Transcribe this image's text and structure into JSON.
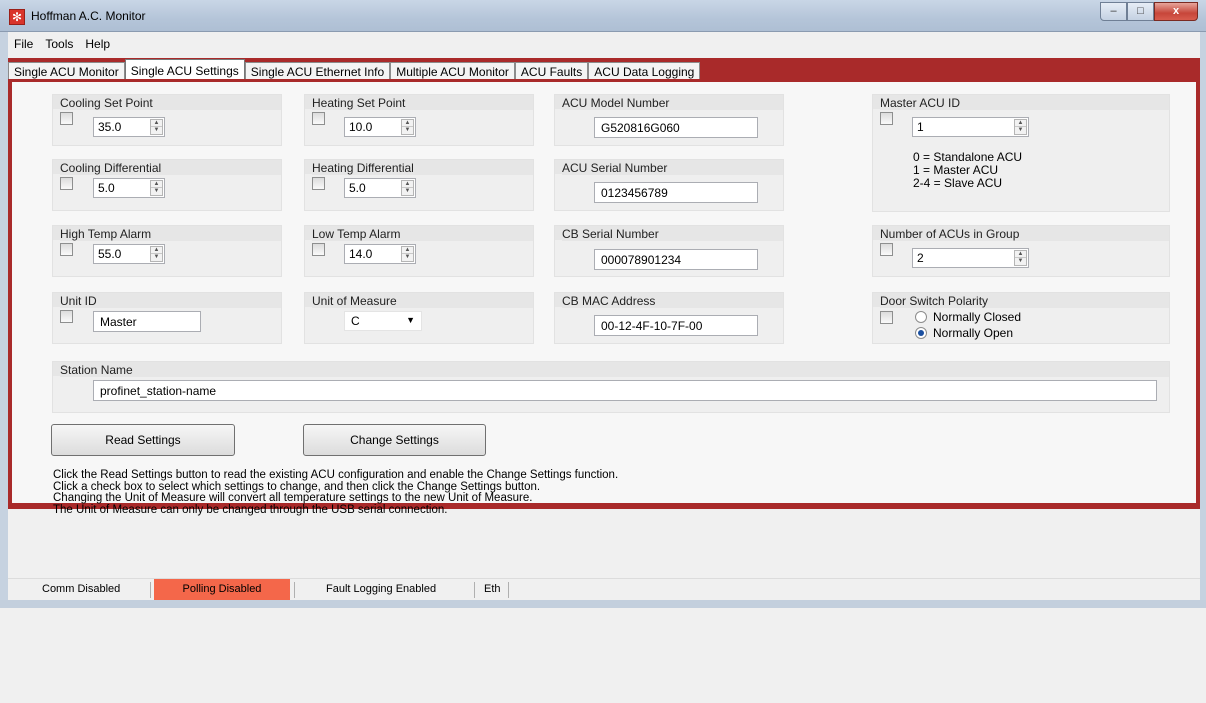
{
  "window": {
    "title": "Hoffman A.C. Monitor",
    "minimize_glyph": "–",
    "maximize_glyph": "□",
    "close_glyph": "x"
  },
  "menu": [
    "File",
    "Tools",
    "Help"
  ],
  "tabs": [
    {
      "label": "Single ACU Monitor",
      "active": false
    },
    {
      "label": "Single ACU Settings",
      "active": true
    },
    {
      "label": "Single ACU Ethernet Info",
      "active": false
    },
    {
      "label": "Multiple ACU Monitor",
      "active": false
    },
    {
      "label": "ACU Faults",
      "active": false
    },
    {
      "label": "ACU Data Logging",
      "active": false
    }
  ],
  "settings": {
    "cooling_set_point": {
      "label": "Cooling Set Point",
      "value": "35.0"
    },
    "heating_set_point": {
      "label": "Heating Set Point",
      "value": "10.0"
    },
    "cooling_differential": {
      "label": "Cooling Differential",
      "value": "5.0"
    },
    "heating_differential": {
      "label": "Heating Differential",
      "value": "5.0"
    },
    "high_temp_alarm": {
      "label": "High Temp Alarm",
      "value": "55.0"
    },
    "low_temp_alarm": {
      "label": "Low Temp Alarm",
      "value": "14.0"
    },
    "unit_id": {
      "label": "Unit ID",
      "value": "Master"
    },
    "unit_of_measure": {
      "label": "Unit of Measure",
      "value": "C"
    },
    "acu_model_number": {
      "label": "ACU Model Number",
      "value": "G520816G060"
    },
    "acu_serial_number": {
      "label": "ACU Serial Number",
      "value": "0123456789"
    },
    "cb_serial_number": {
      "label": "CB Serial Number",
      "value": "000078901234"
    },
    "cb_mac_address": {
      "label": "CB MAC Address",
      "value": "00-12-4F-10-7F-00"
    },
    "master_acu_id": {
      "label": "Master ACU ID",
      "value": "1",
      "notes": [
        "0 = Standalone ACU",
        "1 = Master ACU",
        "2-4 = Slave ACU"
      ]
    },
    "number_of_acus": {
      "label": "Number of ACUs in Group",
      "value": "2"
    },
    "door_switch_polarity": {
      "label": "Door Switch Polarity",
      "options": [
        {
          "label": "Normally Closed",
          "checked": false
        },
        {
          "label": "Normally Open",
          "checked": true
        }
      ]
    },
    "station_name": {
      "label": "Station Name",
      "value": "profinet_station-name"
    }
  },
  "buttons": {
    "read": "Read Settings",
    "change": "Change Settings"
  },
  "instructions": [
    "Click the Read Settings button to read the existing ACU configuration and enable the Change Settings function.",
    "Click a check box to select which settings to change, and then click the Change Settings button.",
    "Changing the Unit of Measure will convert all temperature settings to the new Unit of Measure.",
    "The Unit of Measure can only be changed through the USB serial connection."
  ],
  "status": {
    "comm": "Comm Disabled",
    "polling": "Polling Disabled",
    "fault_logging": "Fault Logging Enabled",
    "eth": "Eth",
    "polling_color": "#f4674a"
  },
  "colors": {
    "accent": "#a92a2a"
  }
}
